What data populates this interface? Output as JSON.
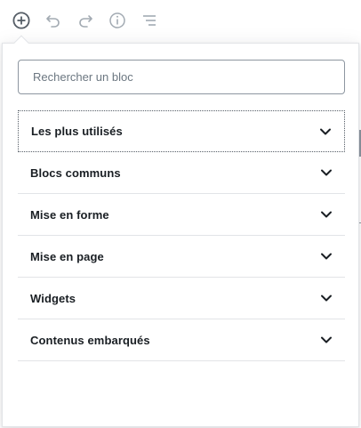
{
  "toolbar": {
    "buttons": [
      {
        "name": "add-block",
        "icon": "plus-circle-icon",
        "state": "active"
      },
      {
        "name": "undo",
        "icon": "undo-icon",
        "state": "disabled"
      },
      {
        "name": "redo",
        "icon": "redo-icon",
        "state": "disabled"
      },
      {
        "name": "content-info",
        "icon": "info-icon",
        "state": "disabled"
      },
      {
        "name": "block-navigation",
        "icon": "list-outline-icon",
        "state": "disabled"
      }
    ]
  },
  "inserter": {
    "search": {
      "placeholder": "Rechercher un bloc",
      "value": ""
    },
    "panels": [
      {
        "label": "Les plus utilisés",
        "expanded": false,
        "focused": true
      },
      {
        "label": "Blocs communs",
        "expanded": false
      },
      {
        "label": "Mise en forme",
        "expanded": false
      },
      {
        "label": "Mise en page",
        "expanded": false
      },
      {
        "label": "Widgets",
        "expanded": false
      },
      {
        "label": "Contenus embarqués",
        "expanded": false
      }
    ]
  },
  "colors": {
    "icon_active": "#555d66",
    "icon_disabled": "#a2aab2",
    "border": "#e2e4e7",
    "input_border": "#8d96a0",
    "text": "#191e23"
  }
}
